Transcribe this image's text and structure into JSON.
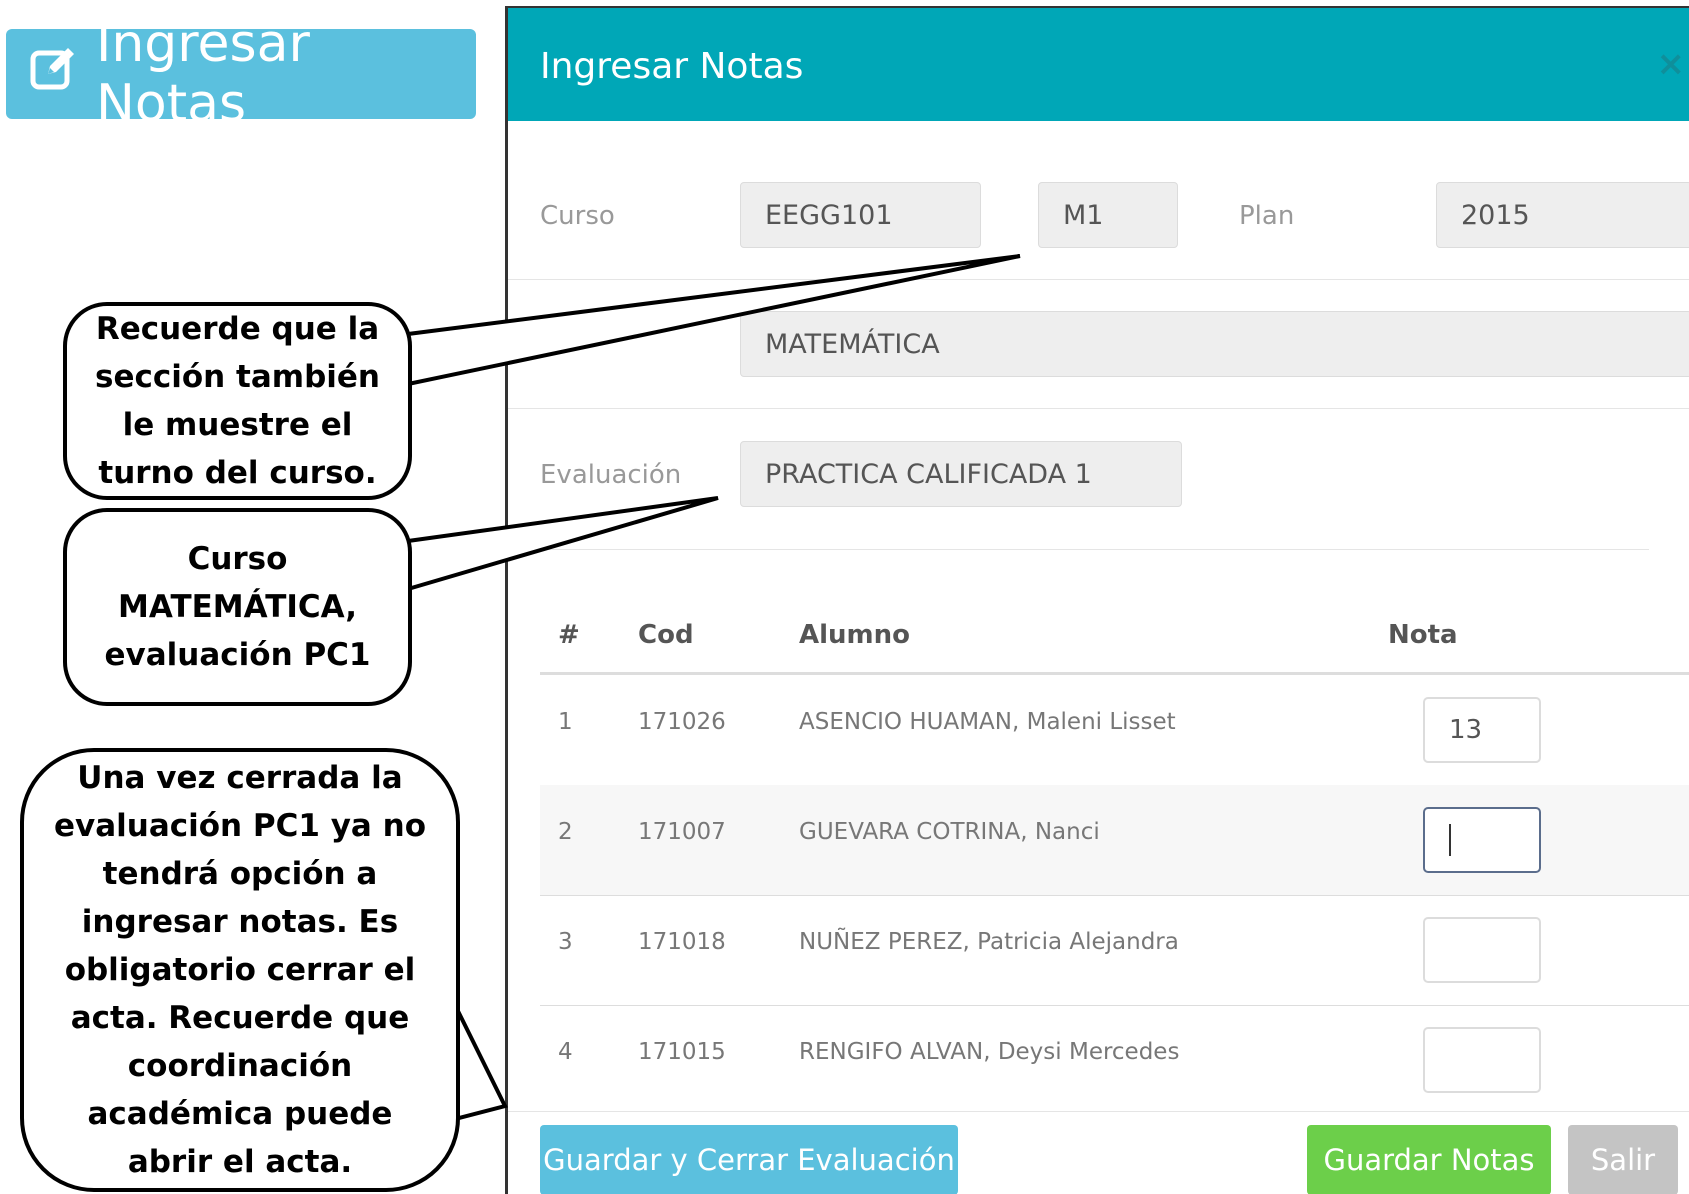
{
  "top_button": {
    "label": "Ingresar Notas",
    "icon": "edit-icon"
  },
  "modal": {
    "title": "Ingresar Notas",
    "close_label": "×",
    "curso_label": "Curso",
    "curso_code": "EEGG101",
    "seccion": "M1",
    "plan_label": "Plan",
    "plan": "2015",
    "course_name": "MATEMÁTICA",
    "evaluacion_label": "Evaluación",
    "evaluacion": "PRACTICA CALIFICADA 1",
    "table": {
      "headers": {
        "num": "#",
        "cod": "Cod",
        "alumno": "Alumno",
        "nota": "Nota"
      },
      "rows": [
        {
          "num": "1",
          "cod": "171026",
          "alumno": "ASENCIO HUAMAN, Maleni Lisset",
          "nota": "13"
        },
        {
          "num": "2",
          "cod": "171007",
          "alumno": "GUEVARA COTRINA, Nanci",
          "nota": ""
        },
        {
          "num": "3",
          "cod": "171018",
          "alumno": "NUÑEZ PEREZ, Patricia Alejandra",
          "nota": ""
        },
        {
          "num": "4",
          "cod": "171015",
          "alumno": "RENGIFO ALVAN, Deysi Mercedes",
          "nota": ""
        }
      ]
    },
    "buttons": {
      "save_close": "Guardar y Cerrar Evaluación",
      "save": "Guardar Notas",
      "exit": "Salir"
    }
  },
  "callouts": {
    "c1": [
      "Recuerde que la",
      "sección también",
      "le muestre el",
      "turno del curso."
    ],
    "c2": [
      "Curso",
      "MATEMÁTICA,",
      "evaluación PC1"
    ],
    "c3": [
      "Una vez cerrada la",
      "evaluación PC1 ya no",
      "tendrá opción a",
      "ingresar notas. Es",
      "obligatorio cerrar el",
      "acta. Recuerde que",
      "coordinación",
      "académica puede",
      "abrir el acta."
    ]
  },
  "colors": {
    "header": "#00a7b7",
    "info_button": "#5bc0de",
    "success_button": "#6ccf4a",
    "disabled_button": "#c4c4c4"
  }
}
